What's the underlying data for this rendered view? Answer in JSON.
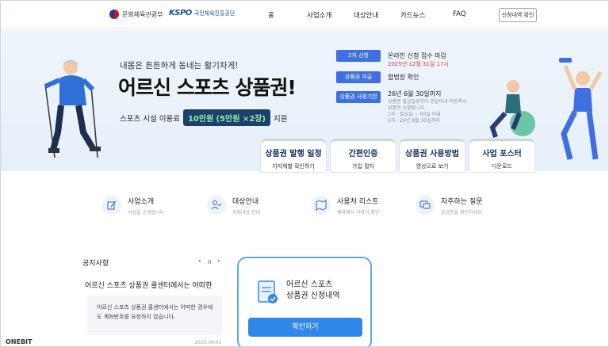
{
  "header": {
    "gov_logo_text": "문화체육관광부",
    "kspo_mark": "KSPO",
    "kspo_text": "국민체육진흥공단",
    "nav": [
      "홈",
      "사업소개",
      "대상안내",
      "카드뉴스",
      "FAQ"
    ],
    "cta": "신청내역 확인"
  },
  "hero": {
    "subtitle": "내몸은 튼튼하게 동네는 활기차게!",
    "title": "어르신 스포츠 상품권!",
    "support_prefix": "스포츠 시설 이용료",
    "amount": "10만원",
    "amount_detail": "(5만원 ×2장)",
    "support_suffix": "지원",
    "info": [
      {
        "tag": "2차 신청",
        "text": "온라인 신청 접수 마감",
        "red": "2025년 12월 31일 17시"
      },
      {
        "tag": "상품권 지급",
        "text": "합법장 확인"
      },
      {
        "tag": "상품권 사용기한",
        "text": "26년 6월 30일까지",
        "small": [
          "상품권 발급일로부터 한달이내 미등록시",
          "상품권 소멸됩니다.",
          "1차 : 발급일 ~ 60일 이내",
          "2차 : 26년 8월 30일까지"
        ]
      }
    ],
    "quick_cards": [
      {
        "title": "상품권 발행 일정",
        "sub": "지자체별 확인하기"
      },
      {
        "title": "간편인증",
        "sub": "가입 절차"
      },
      {
        "title": "상품권 사용방법",
        "sub": "영상으로 보기"
      },
      {
        "title": "사업 포스터",
        "sub": "다운로드"
      }
    ]
  },
  "menu": [
    {
      "title": "사업소개",
      "sub": "사업을 소개합니다",
      "icon": "edit-icon"
    },
    {
      "title": "대상안내",
      "sub": "지원대상 안내",
      "icon": "user-check-icon"
    },
    {
      "title": "사용처 리스트",
      "sub": "체육에서 사용처 확인",
      "icon": "map-icon"
    },
    {
      "title": "자주하는 질문",
      "sub": "궁금증을 확인하세요",
      "icon": "chat-icon"
    }
  ],
  "notice": {
    "title": "공지사항",
    "prev": "‹",
    "pause": "II",
    "next": "›",
    "headline": "어르신 스포츠 상품권 콜센터에서는 어떠한",
    "body": "어르신 스포츠 상품권 콜센터에서는 어떠한 경우에도 계좌번호를 요청하지 않습니다.",
    "date": "2025.06.01"
  },
  "check": {
    "title_line1": "어르신 스포츠",
    "title_line2": "상품권 신청내역",
    "button": "확인하기"
  },
  "brand": "ONEBIT",
  "colors": {
    "accent": "#3f6fe0",
    "navy": "#13315c",
    "button": "#2f87ea",
    "alert": "#e53935"
  }
}
